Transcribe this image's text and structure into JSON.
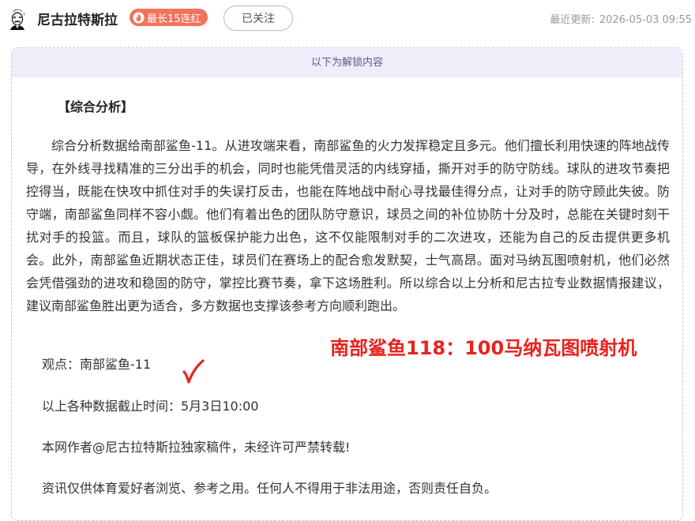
{
  "header": {
    "author_name": "尼古拉特斯拉",
    "streak_badge": "最长15连红",
    "follow_button": "已关注",
    "last_updated_label": "最近更新:",
    "last_updated_value": "2026-05-03 09:55"
  },
  "panel": {
    "unlock_banner": "以下为解锁内容",
    "section_title": "【综合分析】",
    "analysis": "综合分析数据给南部鲨鱼-11。从进攻端来看，南部鲨鱼的火力发挥稳定且多元。他们擅长利用快速的阵地战传导，在外线寻找精准的三分出手的机会，同时也能凭借灵活的内线穿插，撕开对手的防守防线。球队的进攻节奏把控得当，既能在快攻中抓住对手的失误打反击，也能在阵地战中耐心寻找最佳得分点，让对手的防守顾此失彼。防守端，南部鲨鱼同样不容小觑。他们有着出色的团队防守意识，球员之间的补位协防十分及时，总能在关键时刻干扰对手的投篮。而且，球队的篮板保护能力出色，这不仅能限制对手的二次进攻，还能为自己的反击提供更多机会。此外，南部鲨鱼近期状态正佳，球员们在赛场上的配合愈发默契，士气高昂。面对马纳瓦图喷射机，他们必然会凭借强劲的进攻和稳固的防守，掌控比赛节奏，拿下这场胜利。所以综合以上分析和尼古拉专业数据情报建议，建议南部鲨鱼胜出更为适合，多方数据也支撑该参考方向顺利跑出。",
    "viewpoint": "观点：南部鲨鱼-11",
    "cutoff": "以上各种数据截止时间：5月3日10:00",
    "copyright": "本网作者@尼古拉特斯拉独家稿件，未经许可严禁转载!",
    "disclaimer": "资讯仅供体育爱好者浏览、参考之用。任何人不得用于非法用途，否则责任自负。",
    "result_stamp": "南部鲨鱼118：100马纳瓦图喷射机"
  },
  "colors": {
    "badge": "#f3735b",
    "banner_bg": "#efedfa",
    "stamp": "#e8231c"
  },
  "icons": {
    "avatar": "tesla-portrait-avatar",
    "badge": "flame-icon",
    "result": "check-mark-icon"
  }
}
